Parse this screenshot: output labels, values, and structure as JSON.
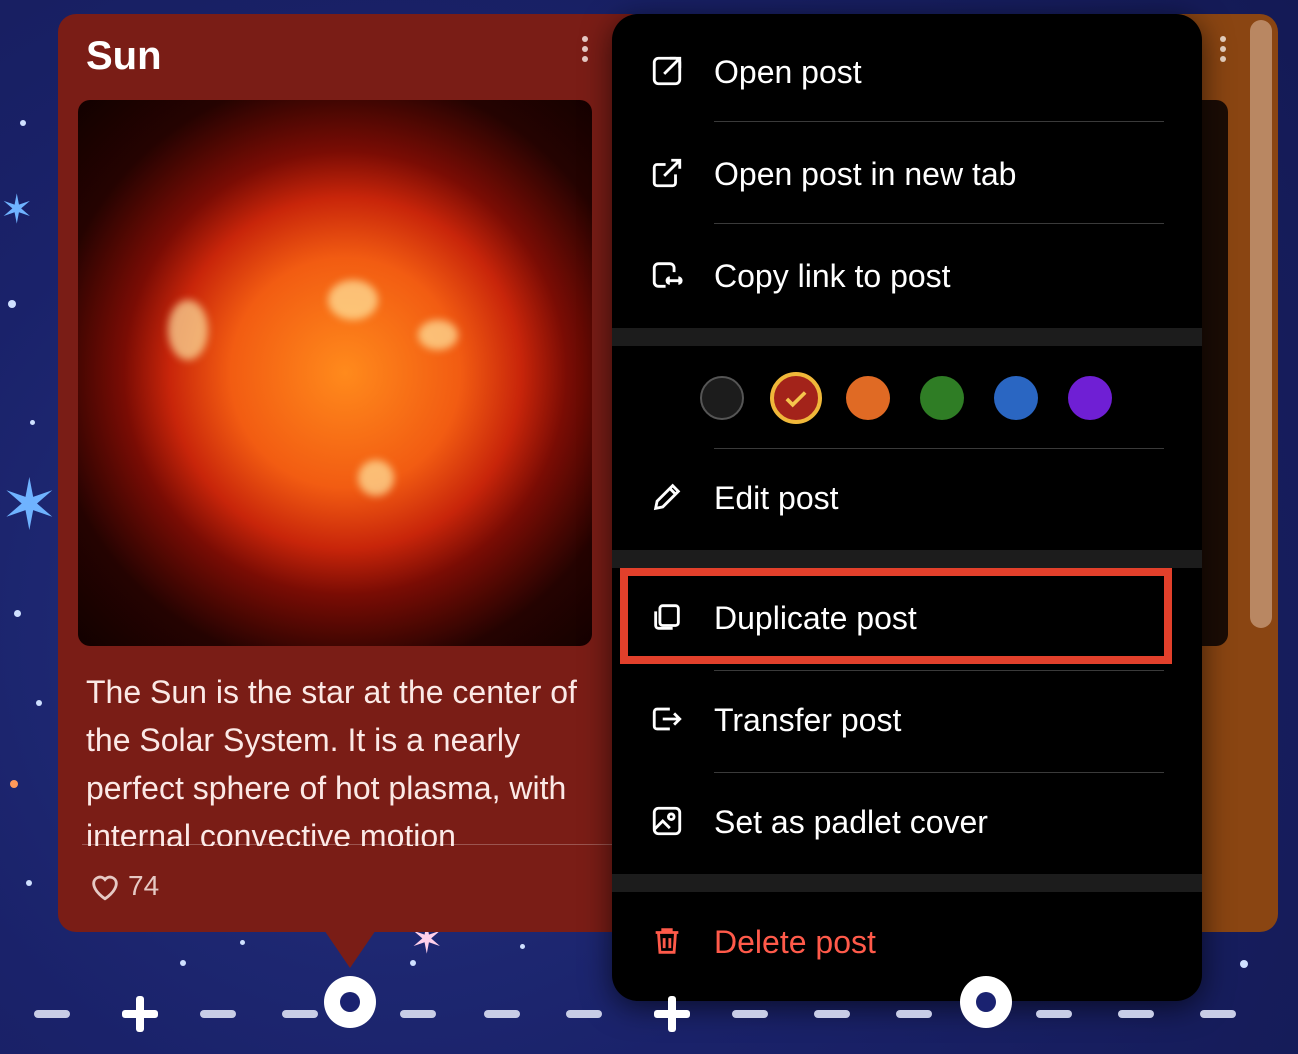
{
  "post": {
    "title": "Sun",
    "body": "The Sun is the star at the center of the Solar System. It is a nearly perfect sphere of hot plasma, with internal convective motion",
    "likes": "74"
  },
  "menu": {
    "items": [
      {
        "label": "Open post",
        "icon": "expand-icon"
      },
      {
        "label": "Open post in new tab",
        "icon": "external-link-icon"
      },
      {
        "label": "Copy link to post",
        "icon": "copy-link-icon"
      },
      {
        "label": "Edit post",
        "icon": "pencil-icon"
      },
      {
        "label": "Duplicate post",
        "icon": "duplicate-icon"
      },
      {
        "label": "Transfer post",
        "icon": "transfer-icon"
      },
      {
        "label": "Set as padlet cover",
        "icon": "image-icon"
      },
      {
        "label": "Delete post",
        "icon": "trash-icon"
      }
    ],
    "colors": [
      {
        "name": "black",
        "hex": "#1c1c1c",
        "selected": false
      },
      {
        "name": "red",
        "hex": "#a3231a",
        "selected": true
      },
      {
        "name": "orange",
        "hex": "#e06a24",
        "selected": false
      },
      {
        "name": "green",
        "hex": "#2f7d25",
        "selected": false
      },
      {
        "name": "blue",
        "hex": "#2a66c2",
        "selected": false
      },
      {
        "name": "purple",
        "hex": "#6f1fd4",
        "selected": false
      }
    ],
    "highlighted_item": "Duplicate post"
  },
  "colors": {
    "card_bg": "#7a1d16",
    "menu_bg": "#000000",
    "danger": "#ff5a4a",
    "highlight_border": "#e2402b"
  }
}
